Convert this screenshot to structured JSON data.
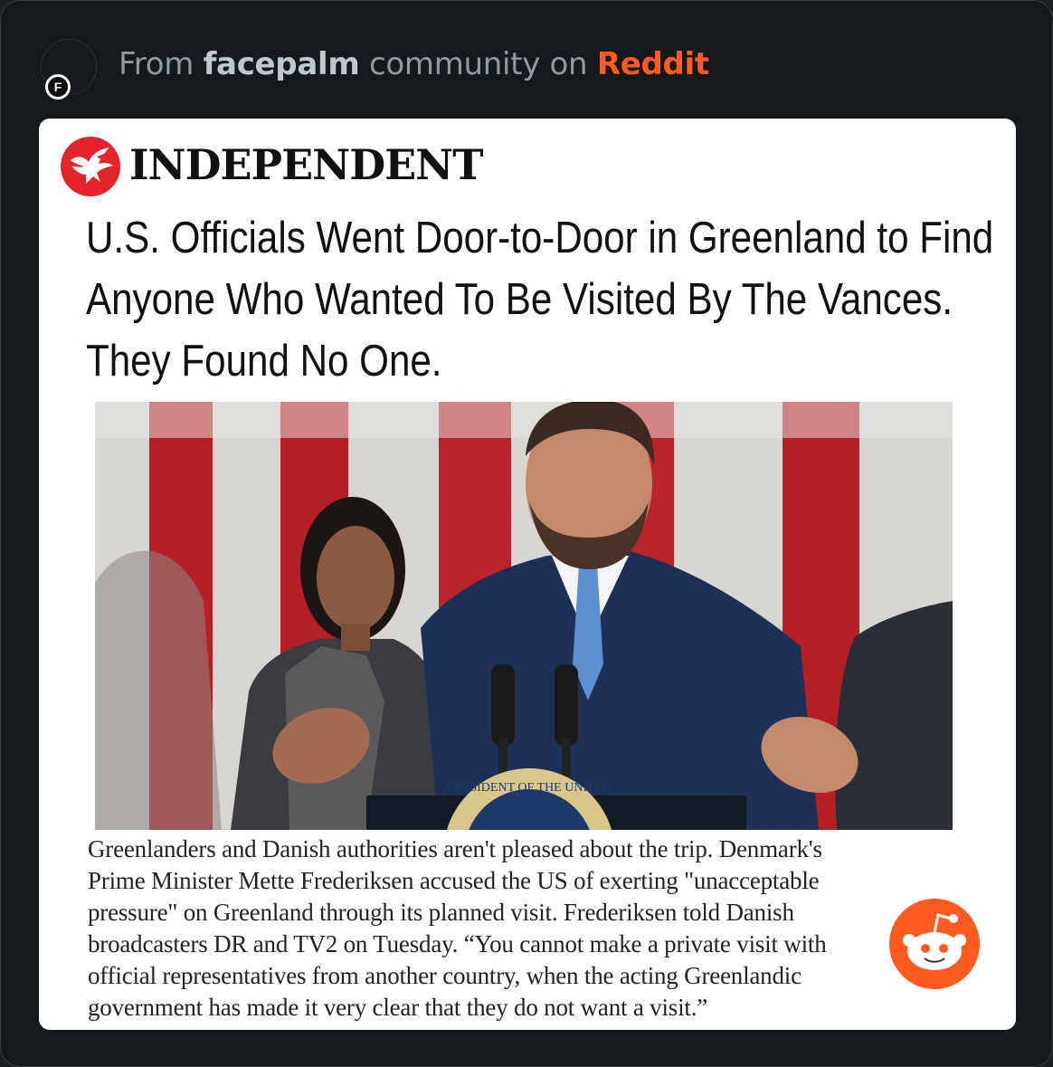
{
  "header": {
    "prefix": "From",
    "community": "facepalm",
    "middle": "community on",
    "platform": "Reddit",
    "avatar_letter": "F"
  },
  "article": {
    "publication": "INDEPENDENT",
    "headline_lines": [
      "U.S. Officials Went Door-to-Door in Greenland to Find",
      "Anyone Who Wanted To Be Visited By The Vances.",
      "They Found No One."
    ],
    "caption_lines": [
      "Greenlanders and Danish authorities aren't pleased about the trip. Denmark's",
      "Prime Minister Mette Frederiksen accused the US of exerting \"unacceptable",
      "pressure\" on Greenland through its planned visit. Frederiksen told Danish",
      "broadcasters DR and TV2 on Tuesday. “You cannot make a private visit with",
      "official representatives from another country, when the acting Greenlandic",
      "government has made it very clear that they do not want a visit.”"
    ],
    "seal_text": "PRESIDENT OF THE UNITED"
  },
  "colors": {
    "background": "#16191c",
    "reddit_orange": "#ff5a1f",
    "independent_red": "#e3242b"
  },
  "icons": [
    "community-avatar-icon",
    "independent-eagle-logo",
    "reddit-snoo-icon"
  ]
}
